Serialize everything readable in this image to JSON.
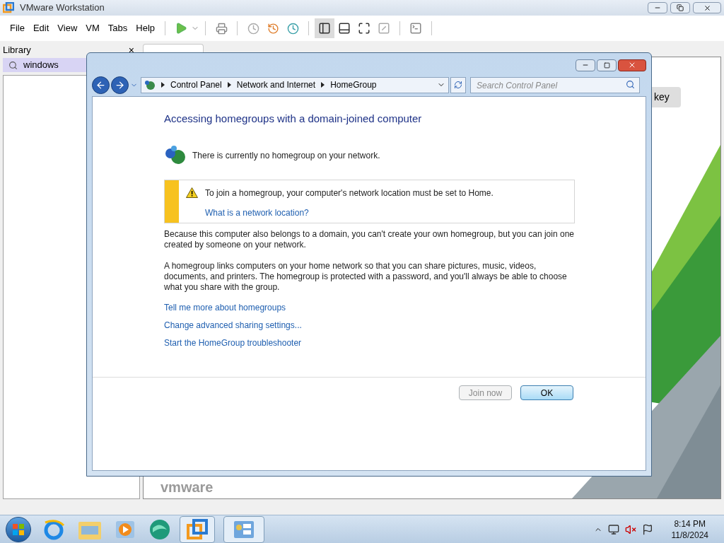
{
  "app_window": {
    "title": "VMware Workstation",
    "menu": [
      "File",
      "Edit",
      "View",
      "VM",
      "Tabs",
      "Help"
    ]
  },
  "library": {
    "title": "Library",
    "close": "×",
    "search_value": "windows"
  },
  "home": {
    "button_label": "key",
    "logo": "vmware"
  },
  "dialog": {
    "breadcrumb": [
      "Control Panel",
      "Network and Internet",
      "HomeGroup"
    ],
    "search_placeholder": "Search Control Panel",
    "heading": "Accessing homegroups with a domain-joined computer",
    "status": "There is currently no homegroup on your network.",
    "warning": {
      "text": "To join a homegroup, your computer's network location must be set to Home.",
      "link": "What is a network location?"
    },
    "paragraphs": [
      "Because this computer also belongs to a domain, you can't create your own homegroup, but you can join one created by someone on your network.",
      "A homegroup links computers on your home network so that you can share pictures, music, videos, documents, and printers. The homegroup is protected with a password, and you'll always be able to choose what you share with the group."
    ],
    "links": [
      "Tell me more about homegroups",
      "Change advanced sharing settings...",
      "Start the HomeGroup troubleshooter"
    ],
    "buttons": [
      {
        "label": "Join now",
        "disabled": true
      },
      {
        "label": "OK",
        "disabled": false
      }
    ]
  },
  "taskbar": {
    "time": "8:14 PM",
    "date": "11/8/2024"
  }
}
